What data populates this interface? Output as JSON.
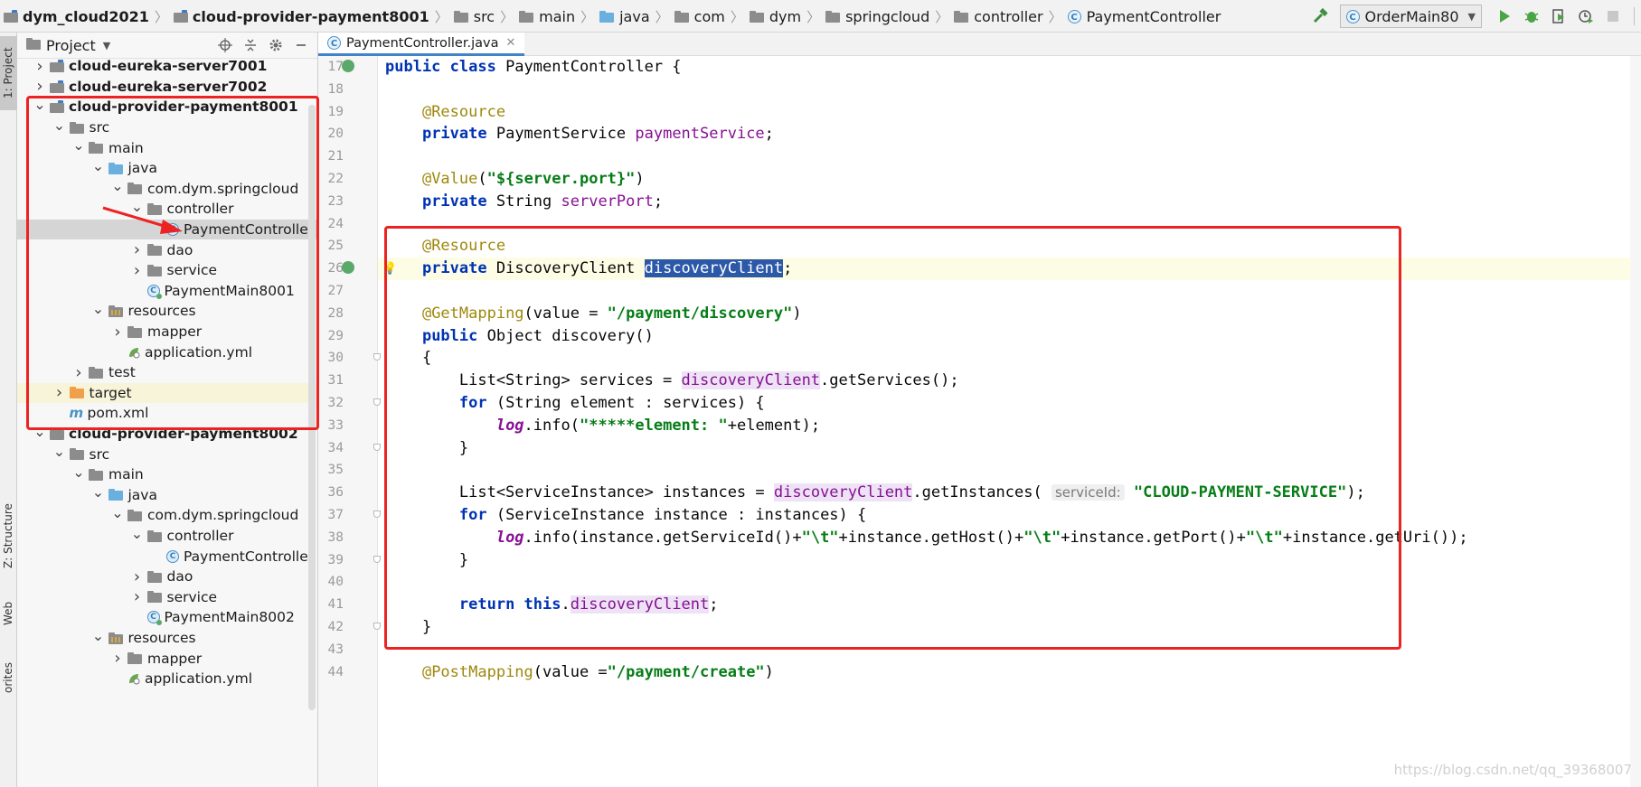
{
  "breadcrumbs": [
    {
      "label": "dym_cloud2021",
      "bold": true,
      "icon": "module-folder-icon"
    },
    {
      "label": "cloud-provider-payment8001",
      "bold": true,
      "icon": "module-folder-icon"
    },
    {
      "label": "src",
      "icon": "folder-icon"
    },
    {
      "label": "main",
      "icon": "folder-icon"
    },
    {
      "label": "java",
      "icon": "source-folder-icon"
    },
    {
      "label": "com",
      "icon": "folder-icon"
    },
    {
      "label": "dym",
      "icon": "folder-icon"
    },
    {
      "label": "springcloud",
      "icon": "folder-icon"
    },
    {
      "label": "controller",
      "icon": "folder-icon"
    },
    {
      "label": "PaymentController",
      "icon": "class-icon"
    }
  ],
  "run_config": {
    "label": "OrderMain80"
  },
  "left_stripe": {
    "project_tab": "1: Project",
    "structure_tab": "Z: Structure",
    "web_tab": "Web",
    "favorites_tab": "orites"
  },
  "project_panel": {
    "title": "Project",
    "items": [
      {
        "label": "cloud-eureka-server7001",
        "type": "module",
        "level": 1,
        "arrow": "right",
        "bold": true
      },
      {
        "label": "cloud-eureka-server7002",
        "type": "module",
        "level": 1,
        "arrow": "right",
        "bold": true
      },
      {
        "label": "cloud-provider-payment8001",
        "type": "module",
        "level": 1,
        "arrow": "down",
        "bold": true
      },
      {
        "label": "src",
        "type": "gray",
        "level": 2,
        "arrow": "down"
      },
      {
        "label": "main",
        "type": "gray",
        "level": 3,
        "arrow": "down"
      },
      {
        "label": "java",
        "type": "blue",
        "level": 4,
        "arrow": "down"
      },
      {
        "label": "com.dym.springcloud",
        "type": "pkg",
        "level": 5,
        "arrow": "down"
      },
      {
        "label": "controller",
        "type": "pkg",
        "level": 6,
        "arrow": "down"
      },
      {
        "label": "PaymentController",
        "type": "class",
        "level": 7,
        "arrow": "",
        "selected": true
      },
      {
        "label": "dao",
        "type": "pkg",
        "level": 6,
        "arrow": "right"
      },
      {
        "label": "service",
        "type": "pkg",
        "level": 6,
        "arrow": "right"
      },
      {
        "label": "PaymentMain8001",
        "type": "mainclass",
        "level": 6,
        "arrow": ""
      },
      {
        "label": "resources",
        "type": "res",
        "level": 4,
        "arrow": "down"
      },
      {
        "label": "mapper",
        "type": "pkg",
        "level": 5,
        "arrow": "right"
      },
      {
        "label": "application.yml",
        "type": "yml",
        "level": 5,
        "arrow": ""
      },
      {
        "label": "test",
        "type": "gray",
        "level": 3,
        "arrow": "right"
      },
      {
        "label": "target",
        "type": "orange",
        "level": 2,
        "arrow": "right",
        "target": true
      },
      {
        "label": "pom.xml",
        "type": "maven",
        "level": 2,
        "arrow": ""
      },
      {
        "label": "cloud-provider-payment8002",
        "type": "module",
        "level": 1,
        "arrow": "down",
        "bold": true
      },
      {
        "label": "src",
        "type": "gray",
        "level": 2,
        "arrow": "down"
      },
      {
        "label": "main",
        "type": "gray",
        "level": 3,
        "arrow": "down"
      },
      {
        "label": "java",
        "type": "blue",
        "level": 4,
        "arrow": "down"
      },
      {
        "label": "com.dym.springcloud",
        "type": "pkg",
        "level": 5,
        "arrow": "down"
      },
      {
        "label": "controller",
        "type": "pkg",
        "level": 6,
        "arrow": "down"
      },
      {
        "label": "PaymentController",
        "type": "class",
        "level": 7,
        "arrow": ""
      },
      {
        "label": "dao",
        "type": "pkg",
        "level": 6,
        "arrow": "right"
      },
      {
        "label": "service",
        "type": "pkg",
        "level": 6,
        "arrow": "right"
      },
      {
        "label": "PaymentMain8002",
        "type": "mainclass",
        "level": 6,
        "arrow": ""
      },
      {
        "label": "resources",
        "type": "res",
        "level": 4,
        "arrow": "down"
      },
      {
        "label": "mapper",
        "type": "pkg",
        "level": 5,
        "arrow": "right"
      },
      {
        "label": "application.yml",
        "type": "yml",
        "level": 5,
        "arrow": ""
      }
    ]
  },
  "editor": {
    "tab_label": "PaymentController.java",
    "lines": [
      {
        "n": "17",
        "icon": true,
        "tokens": [
          [
            "kw",
            "public class "
          ],
          [
            "",
            "PaymentController {"
          ]
        ]
      },
      {
        "n": "18",
        "tokens": []
      },
      {
        "n": "19",
        "tokens": [
          [
            "",
            "    "
          ],
          [
            "an",
            "@Resource"
          ]
        ]
      },
      {
        "n": "20",
        "tokens": [
          [
            "",
            "    "
          ],
          [
            "kw",
            "private "
          ],
          [
            "",
            "PaymentService "
          ],
          [
            "fd",
            "paymentService"
          ],
          [
            "",
            ";"
          ]
        ]
      },
      {
        "n": "21",
        "tokens": []
      },
      {
        "n": "22",
        "tokens": [
          [
            "",
            "    "
          ],
          [
            "an",
            "@Value"
          ],
          [
            "",
            "("
          ],
          [
            "st",
            "\"${server.port}\""
          ],
          [
            "",
            ")"
          ]
        ]
      },
      {
        "n": "23",
        "tokens": [
          [
            "",
            "    "
          ],
          [
            "kw",
            "private "
          ],
          [
            "",
            "String "
          ],
          [
            "fd",
            "serverPort"
          ],
          [
            "",
            ";"
          ]
        ]
      },
      {
        "n": "24",
        "tokens": []
      },
      {
        "n": "25",
        "tokens": [
          [
            "",
            "    "
          ],
          [
            "an",
            "@Resource"
          ]
        ]
      },
      {
        "n": "26",
        "icon": true,
        "bulb": true,
        "highlight": true,
        "tokens": [
          [
            "",
            "    "
          ],
          [
            "kw",
            "private "
          ],
          [
            "",
            "DiscoveryClient "
          ],
          [
            "sel",
            "discoveryClient"
          ],
          [
            "",
            ";"
          ]
        ]
      },
      {
        "n": "27",
        "tokens": []
      },
      {
        "n": "28",
        "tokens": [
          [
            "",
            "    "
          ],
          [
            "an",
            "@GetMapping"
          ],
          [
            "",
            "(value = "
          ],
          [
            "st",
            "\"/payment/discovery\""
          ],
          [
            "",
            ")"
          ]
        ]
      },
      {
        "n": "29",
        "tokens": [
          [
            "",
            "    "
          ],
          [
            "kw",
            "public "
          ],
          [
            "",
            "Object discovery()"
          ]
        ]
      },
      {
        "n": "30",
        "fold": true,
        "tokens": [
          [
            "",
            "    {"
          ]
        ]
      },
      {
        "n": "31",
        "tokens": [
          [
            "",
            "        List<String> services = "
          ],
          [
            "fdbg",
            "discoveryClient"
          ],
          [
            "",
            ".getServices();"
          ]
        ]
      },
      {
        "n": "32",
        "fold": true,
        "tokens": [
          [
            "",
            "        "
          ],
          [
            "kw",
            "for "
          ],
          [
            "",
            "(String element : services) {"
          ]
        ]
      },
      {
        "n": "33",
        "tokens": [
          [
            "",
            "            "
          ],
          [
            "it",
            "log"
          ],
          [
            "",
            ".info("
          ],
          [
            "st",
            "\"*****element: \""
          ],
          [
            "",
            "+element);"
          ]
        ]
      },
      {
        "n": "34",
        "fold": true,
        "tokens": [
          [
            "",
            "        }"
          ]
        ]
      },
      {
        "n": "35",
        "tokens": []
      },
      {
        "n": "36",
        "tokens": [
          [
            "",
            "        List<ServiceInstance> instances = "
          ],
          [
            "fdbg",
            "discoveryClient"
          ],
          [
            "",
            ".getInstances( "
          ],
          [
            "hint",
            "serviceId:"
          ],
          [
            "",
            " "
          ],
          [
            "st",
            "\"CLOUD-PAYMENT-SERVICE\""
          ],
          [
            "",
            ");"
          ]
        ]
      },
      {
        "n": "37",
        "fold": true,
        "tokens": [
          [
            "",
            "        "
          ],
          [
            "kw",
            "for "
          ],
          [
            "",
            "(ServiceInstance instance : instances) {"
          ]
        ]
      },
      {
        "n": "38",
        "tokens": [
          [
            "",
            "            "
          ],
          [
            "it",
            "log"
          ],
          [
            "",
            ".info(instance.getServiceId()+"
          ],
          [
            "st",
            "\"\\t\""
          ],
          [
            "",
            "+instance.getHost()+"
          ],
          [
            "st",
            "\"\\t\""
          ],
          [
            "",
            "+instance.getPort()+"
          ],
          [
            "st",
            "\"\\t\""
          ],
          [
            "",
            "+instance.getUri());"
          ]
        ]
      },
      {
        "n": "39",
        "fold": true,
        "tokens": [
          [
            "",
            "        }"
          ]
        ]
      },
      {
        "n": "40",
        "tokens": []
      },
      {
        "n": "41",
        "tokens": [
          [
            "",
            "        "
          ],
          [
            "kw",
            "return this"
          ],
          [
            "",
            "."
          ],
          [
            "fdbg",
            "discoveryClient"
          ],
          [
            "",
            ";"
          ]
        ]
      },
      {
        "n": "42",
        "fold": true,
        "tokens": [
          [
            "",
            "    }"
          ]
        ]
      },
      {
        "n": "43",
        "tokens": []
      },
      {
        "n": "44",
        "tokens": [
          [
            "",
            "    "
          ],
          [
            "an",
            "@PostMapping"
          ],
          [
            "",
            "(value ="
          ],
          [
            "st",
            "\"/payment/create\""
          ],
          [
            "",
            ")"
          ]
        ]
      }
    ]
  },
  "watermark": "https://blog.csdn.net/qq_39368007",
  "colors": {
    "annotation_red": "#ec2323",
    "selection": "#2b58a8",
    "keyword": "#0033b3",
    "string": "#067d17",
    "field": "#871094"
  }
}
